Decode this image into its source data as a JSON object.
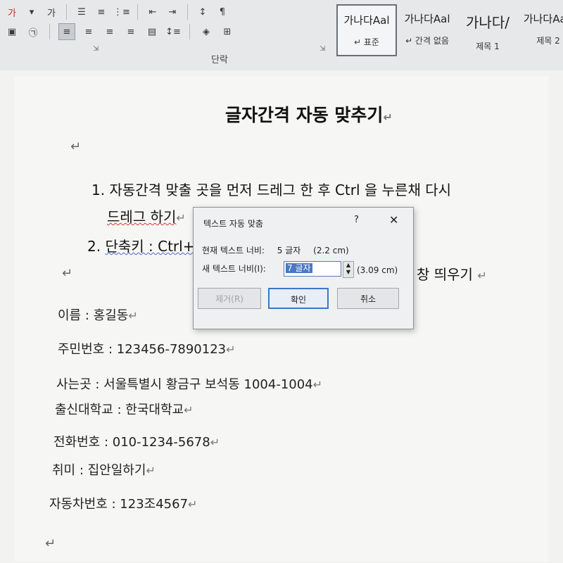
{
  "ribbon": {
    "group_label": "단락",
    "font_buttons": [
      "가",
      "가"
    ],
    "styles": [
      {
        "preview": "가나다Aal",
        "label": "↵ 표준"
      },
      {
        "preview": "가나다Aal",
        "label": "↵ 간격 없음"
      },
      {
        "preview": "가나다/",
        "label": "제목 1"
      },
      {
        "preview": "가나다AaE",
        "label": "제목 2"
      }
    ]
  },
  "document": {
    "title": "글자간격 자동 맞추기",
    "list": [
      {
        "num": "1.",
        "line1": "자동간격 맞출 곳을 먼저 드레그 한 후 Ctrl 을 누른채 다시",
        "line2": "드레그 하기"
      },
      {
        "num": "2.",
        "text_start": "단축키 : Ctrl+",
        "text_end": "창 띄우기"
      }
    ],
    "fields": [
      "이름 : 홍길동",
      "주민번호 : 123456-7890123",
      "사는곳 : 서울특별시 황금구 보석동 1004-1004",
      "출신대학교 : 한국대학교",
      "전화번호 : 010-1234-5678",
      "취미 : 집안일하기",
      "자동차번호 : 123조4567"
    ]
  },
  "dialog": {
    "title": "텍스트 자동 맞춤",
    "help": "?",
    "current_label": "현재 텍스트 너비:",
    "current_value": "5 글자",
    "current_cm": "(2.2 cm)",
    "new_label": "새 텍스트 너비(I):",
    "new_value": "7 글자",
    "new_cm": "(3.09 cm)",
    "remove_btn": "제거(R)",
    "ok_btn": "확인",
    "cancel_btn": "취소"
  }
}
